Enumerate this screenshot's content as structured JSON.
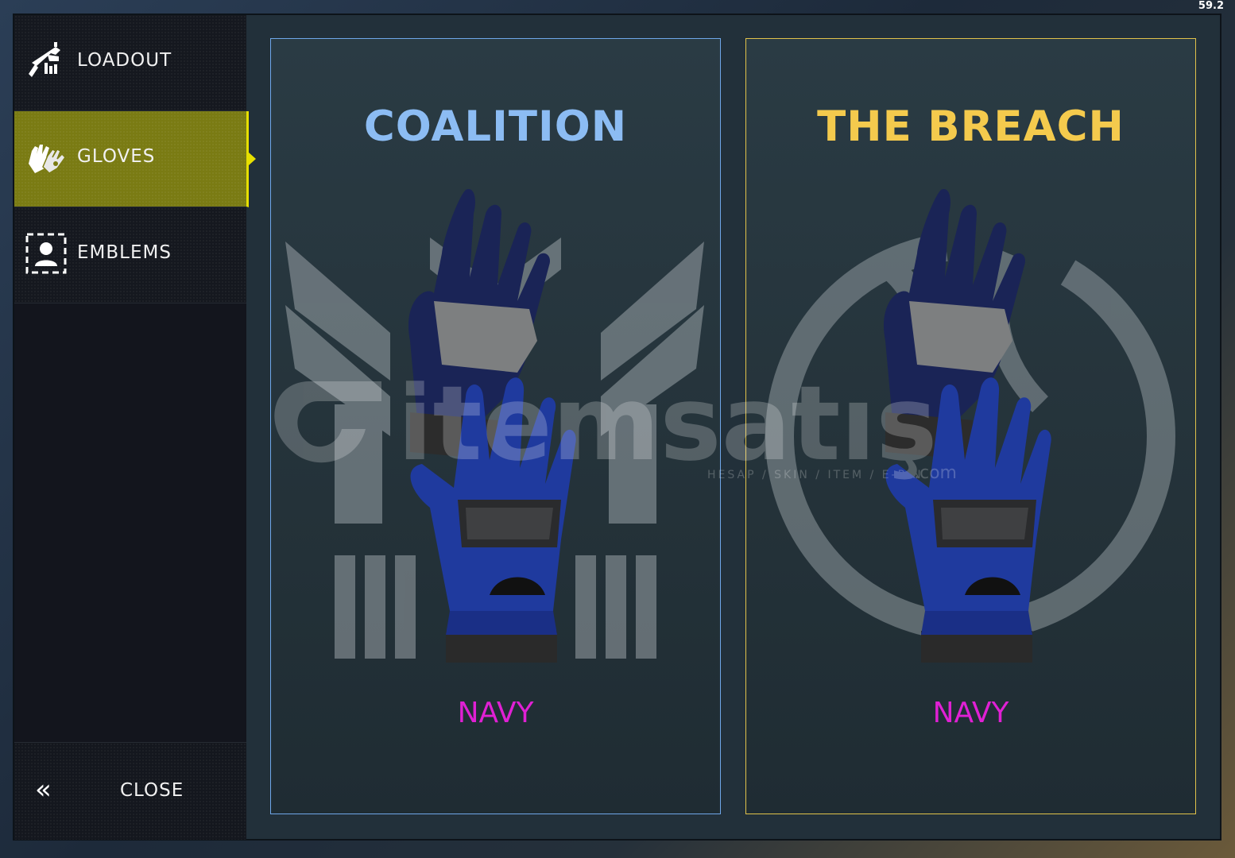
{
  "fps": "59.2",
  "sidebar": {
    "items": [
      {
        "label": "LOADOUT",
        "icon": "loadout-icon",
        "active": false
      },
      {
        "label": "GLOVES",
        "icon": "gloves-icon",
        "active": true
      },
      {
        "label": "EMBLEMS",
        "icon": "emblems-icon",
        "active": false
      }
    ],
    "close_label": "CLOSE",
    "close_icon": "double-chevron-left-icon"
  },
  "cards": [
    {
      "title": "COALITION",
      "variant": "NAVY",
      "accent": "#8cbcf3",
      "border": "#6fa7ea",
      "emblem": "coalition-wings-emblem"
    },
    {
      "title": "THE BREACH",
      "variant": "NAVY",
      "accent": "#f4ca4d",
      "border": "#e1c24a",
      "emblem": "breach-circle-emblem"
    }
  ],
  "colors": {
    "active_item": "#7a7b13",
    "active_indicator": "#e7e000",
    "variant_text": "#e020d4"
  },
  "watermark": {
    "brand": "itemsatış",
    "tagline": "HESAP / SKIN / ITEM / E-PIN",
    "domain": ".com"
  }
}
